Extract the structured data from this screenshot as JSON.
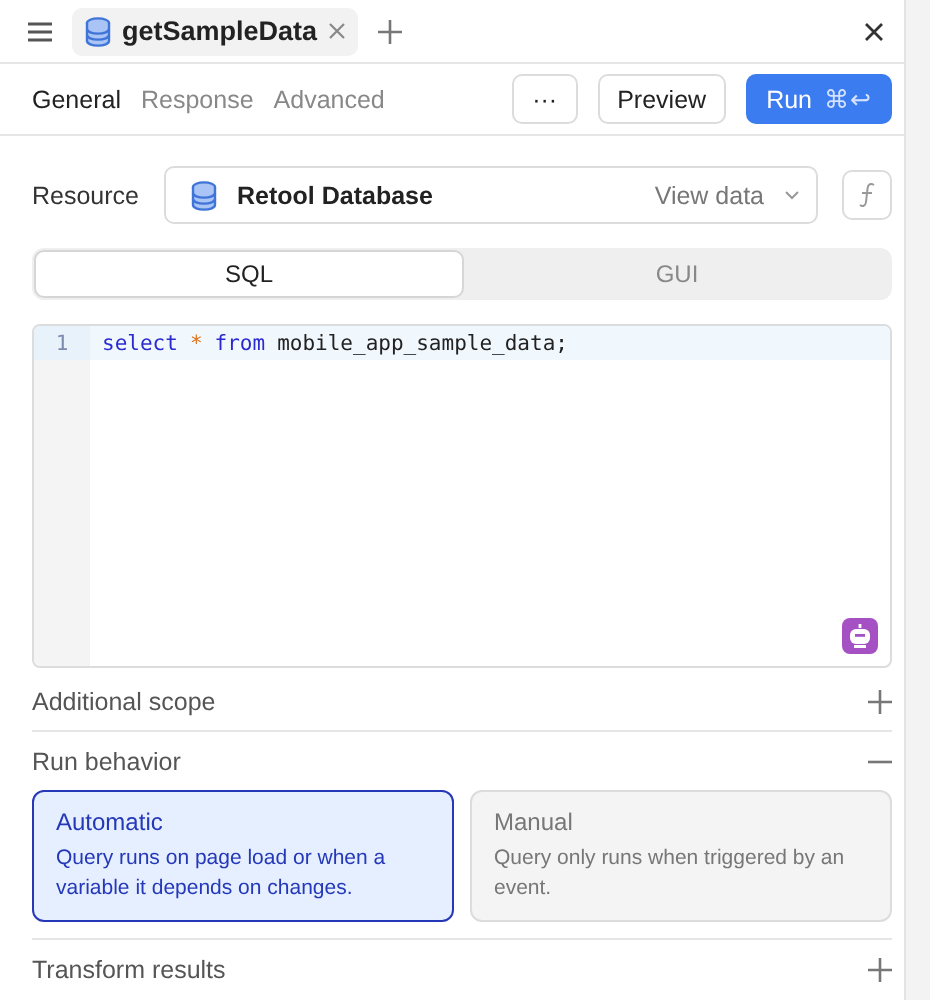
{
  "header": {
    "tab_title": "getSampleData"
  },
  "nav_tabs": [
    {
      "label": "General",
      "selected": true
    },
    {
      "label": "Response",
      "selected": false
    },
    {
      "label": "Advanced",
      "selected": false
    }
  ],
  "actions": {
    "more": "···",
    "preview": "Preview",
    "run": "Run",
    "run_shortcut": "⌘↩"
  },
  "resource": {
    "label": "Resource",
    "value": "Retool Database",
    "link": "View data"
  },
  "mode_tabs": [
    {
      "label": "SQL",
      "selected": true
    },
    {
      "label": "GUI",
      "selected": false
    }
  ],
  "editor": {
    "lines": [
      {
        "number": "1",
        "tokens": [
          {
            "kind": "keyword",
            "text": "select"
          },
          {
            "kind": "operator",
            "text": "*"
          },
          {
            "kind": "keyword",
            "text": "from"
          },
          {
            "kind": "plain",
            "text": "mobile_app_sample_data;"
          }
        ]
      }
    ]
  },
  "sections": [
    {
      "title": "Additional scope",
      "expanded": false
    },
    {
      "title": "Run behavior",
      "expanded": true
    }
  ],
  "run_options": [
    {
      "title": "Automatic",
      "description": "Query runs on page load or when a variable it depends on changes.",
      "selected": true
    },
    {
      "title": "Manual",
      "description": "Query only runs when triggered by an event.",
      "selected": false
    }
  ],
  "footer_section": {
    "title": "Transform results",
    "expanded": false
  }
}
